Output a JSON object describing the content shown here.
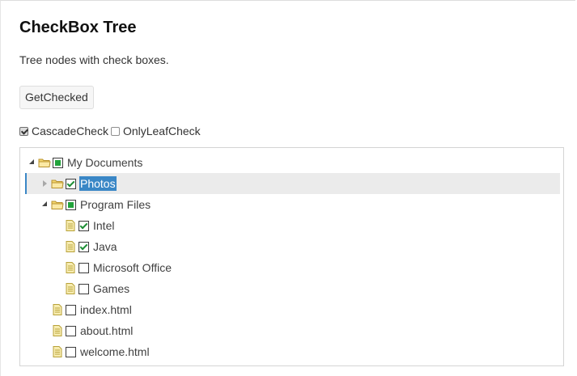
{
  "title": "CheckBox Tree",
  "description": "Tree nodes with check boxes.",
  "get_checked_label": "GetChecked",
  "options": {
    "cascade": {
      "label": "CascadeCheck",
      "checked": true
    },
    "only_leaf": {
      "label": "OnlyLeafCheck",
      "checked": false
    }
  },
  "tree": {
    "nodes": [
      {
        "label": "My Documents",
        "level": 0,
        "type": "folder",
        "state": "expanded",
        "check": "partial",
        "selected": false
      },
      {
        "label": "Photos",
        "level": 1,
        "type": "folder",
        "state": "collapsed",
        "check": "checked",
        "selected": true
      },
      {
        "label": "Program Files",
        "level": 1,
        "type": "folder",
        "state": "expanded",
        "check": "partial",
        "selected": false
      },
      {
        "label": "Intel",
        "level": 2,
        "type": "file",
        "state": "leaf",
        "check": "checked",
        "selected": false
      },
      {
        "label": "Java",
        "level": 2,
        "type": "file",
        "state": "leaf",
        "check": "checked",
        "selected": false
      },
      {
        "label": "Microsoft Office",
        "level": 2,
        "type": "file",
        "state": "leaf",
        "check": "unchecked",
        "selected": false
      },
      {
        "label": "Games",
        "level": 2,
        "type": "file",
        "state": "leaf",
        "check": "unchecked",
        "selected": false
      },
      {
        "label": "index.html",
        "level": 1,
        "type": "file",
        "state": "leaf",
        "check": "unchecked",
        "selected": false
      },
      {
        "label": "about.html",
        "level": 1,
        "type": "file",
        "state": "leaf",
        "check": "unchecked",
        "selected": false
      },
      {
        "label": "welcome.html",
        "level": 1,
        "type": "file",
        "state": "leaf",
        "check": "unchecked",
        "selected": false
      }
    ]
  },
  "colors": {
    "selection": "#3a87c6",
    "check": "#22a33b",
    "folder": "#f5d76e",
    "file": "#f7ecb0"
  }
}
